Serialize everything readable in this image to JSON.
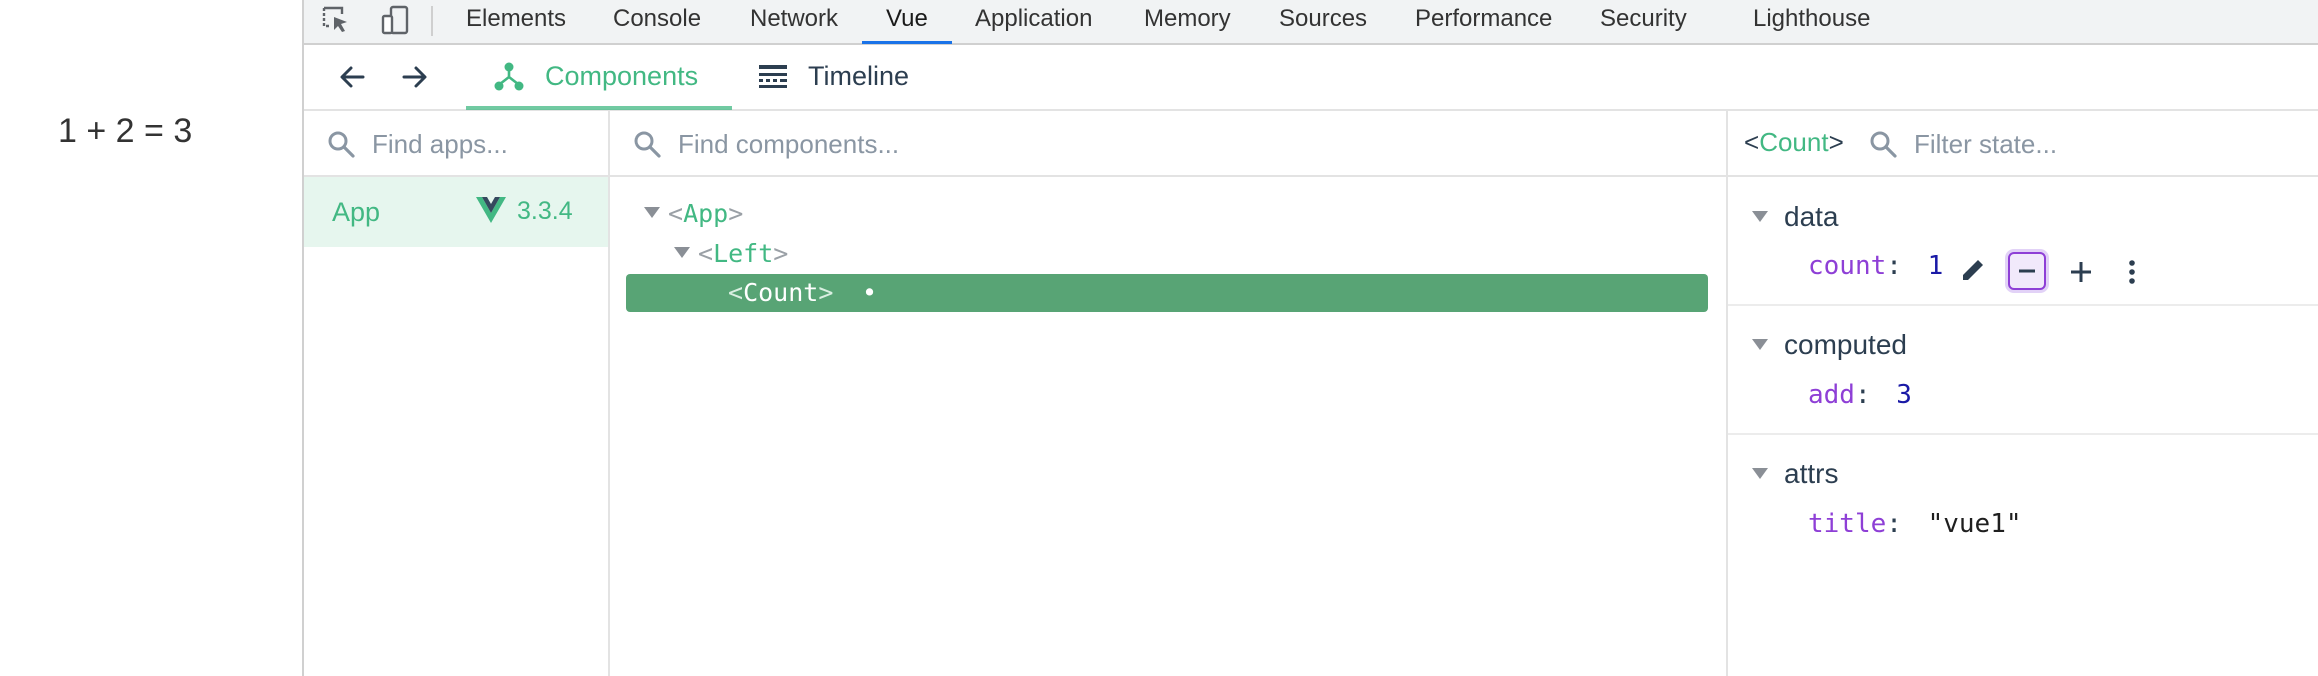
{
  "page": {
    "result_text": "1 + 2 = 3"
  },
  "devtools": {
    "tabs": [
      "Elements",
      "Console",
      "Network",
      "Vue",
      "Application",
      "Memory",
      "Sources",
      "Performance",
      "Security",
      "Lighthouse"
    ],
    "active_tab": "Vue",
    "accent_color": "#1a73e8"
  },
  "vue_toolbar": {
    "tabs": [
      {
        "label": "Components",
        "icon": "components-tree-icon",
        "active": true
      },
      {
        "label": "Timeline",
        "icon": "timeline-icon",
        "active": false
      }
    ],
    "accent_color": "#42b883"
  },
  "apps_panel": {
    "search_placeholder": "Find apps...",
    "apps": [
      {
        "name": "App",
        "version": "3.3.4",
        "selected": true
      }
    ]
  },
  "tree_panel": {
    "search_placeholder": "Find components...",
    "nodes": [
      {
        "open": "<",
        "name": "App",
        "close": ">",
        "expanded": true,
        "selected": false
      },
      {
        "open": "<",
        "name": "Left",
        "close": ">",
        "expanded": true,
        "selected": false
      },
      {
        "open": "<",
        "name": "Count",
        "close": ">",
        "expanded": false,
        "selected": true,
        "marker": "•"
      }
    ]
  },
  "state_panel": {
    "component": {
      "open": "<",
      "name": "Count",
      "close": ">"
    },
    "filter_placeholder": "Filter state...",
    "sections": [
      {
        "label": "data",
        "props": [
          {
            "key": "count",
            "colon": ":",
            "value": "1"
          }
        ]
      },
      {
        "label": "computed",
        "props": [
          {
            "key": "add",
            "colon": ":",
            "value": "3"
          }
        ]
      },
      {
        "label": "attrs",
        "props": [
          {
            "key": "title",
            "colon": ":",
            "value": "\"vue1\""
          }
        ]
      }
    ]
  }
}
